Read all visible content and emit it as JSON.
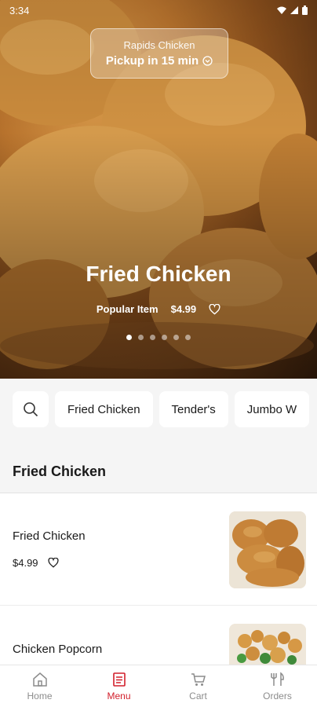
{
  "status_bar": {
    "time": "3:34"
  },
  "hero": {
    "store_name": "Rapids Chicken",
    "pickup_text": "Pickup in 15 min",
    "title": "Fried Chicken",
    "tag": "Popular Item",
    "price": "$4.99",
    "slide_count": 6,
    "active_slide": 1
  },
  "categories": [
    "Fried Chicken",
    "Tender's",
    "Jumbo W"
  ],
  "section": {
    "title": "Fried Chicken"
  },
  "menu_items": [
    {
      "name": "Fried Chicken",
      "price": "$4.99"
    },
    {
      "name": "Chicken Popcorn"
    }
  ],
  "nav": [
    {
      "label": "Home",
      "icon": "home-icon",
      "active": false
    },
    {
      "label": "Menu",
      "icon": "menu-icon",
      "active": true
    },
    {
      "label": "Cart",
      "icon": "cart-icon",
      "active": false
    },
    {
      "label": "Orders",
      "icon": "utensils-icon",
      "active": false
    }
  ],
  "colors": {
    "accent": "#d21f2b",
    "inactive": "#8c8c8c",
    "background": "#f5f5f5"
  }
}
